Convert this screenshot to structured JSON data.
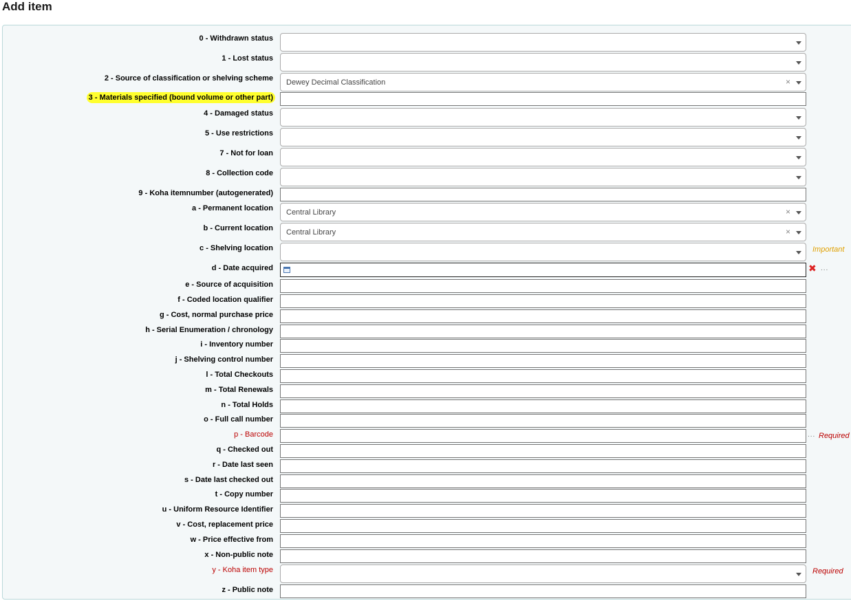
{
  "page": {
    "title": "Add item"
  },
  "hints": {
    "important": "Important",
    "required": "Required"
  },
  "colors": {
    "required": "#bb0000",
    "important": "#e0a000",
    "highlight": "#ffff2e",
    "panel_bg": "#f4f8f9",
    "panel_border": "#b9d8d9"
  },
  "fields": {
    "withdrawn": {
      "label": "0 - Withdrawn status",
      "value": ""
    },
    "lost": {
      "label": "1 - Lost status",
      "value": ""
    },
    "classification": {
      "label": "2 - Source of classification or shelving scheme",
      "value": "Dewey Decimal Classification",
      "clear": "×"
    },
    "materials": {
      "label": "3 - Materials specified (bound volume or other part)",
      "value": ""
    },
    "damaged": {
      "label": "4 - Damaged status",
      "value": ""
    },
    "restrictions": {
      "label": "5 - Use restrictions",
      "value": ""
    },
    "notforloan": {
      "label": "7 - Not for loan",
      "value": ""
    },
    "ccode": {
      "label": "8 - Collection code",
      "value": ""
    },
    "itemnumber": {
      "label": "9 - Koha itemnumber (autogenerated)",
      "value": ""
    },
    "permloc": {
      "label": "a - Permanent location",
      "value": "Central Library",
      "clear": "×"
    },
    "curloc": {
      "label": "b - Current location",
      "value": "Central Library",
      "clear": "×"
    },
    "shelvingloc": {
      "label": "c - Shelving location",
      "value": ""
    },
    "dateacq": {
      "label": "d - Date acquired",
      "value": "",
      "clear": "✖",
      "more": "..."
    },
    "acqsource": {
      "label": "e - Source of acquisition",
      "value": ""
    },
    "codedloc": {
      "label": "f - Coded location qualifier",
      "value": ""
    },
    "cost": {
      "label": "g - Cost, normal purchase price",
      "value": ""
    },
    "serial": {
      "label": "h - Serial Enumeration / chronology",
      "value": ""
    },
    "inventory": {
      "label": "i - Inventory number",
      "value": ""
    },
    "shelvingctrl": {
      "label": "j - Shelving control number",
      "value": ""
    },
    "checkouts": {
      "label": "l - Total Checkouts",
      "value": ""
    },
    "renewals": {
      "label": "m - Total Renewals",
      "value": ""
    },
    "holds": {
      "label": "n - Total Holds",
      "value": ""
    },
    "callnum": {
      "label": "o - Full call number",
      "value": ""
    },
    "barcode": {
      "label": "p - Barcode",
      "value": "",
      "more": "..."
    },
    "checkedout": {
      "label": "q - Checked out",
      "value": ""
    },
    "lastseen": {
      "label": "r - Date last seen",
      "value": ""
    },
    "lastcheckedout": {
      "label": "s - Date last checked out",
      "value": ""
    },
    "copynum": {
      "label": "t - Copy number",
      "value": ""
    },
    "uri": {
      "label": "u - Uniform Resource Identifier",
      "value": ""
    },
    "replcost": {
      "label": "v - Cost, replacement price",
      "value": ""
    },
    "priceeff": {
      "label": "w - Price effective from",
      "value": ""
    },
    "nonpublic": {
      "label": "x - Non-public note",
      "value": ""
    },
    "itemtype": {
      "label": "y - Koha item type",
      "value": ""
    },
    "publicnote": {
      "label": "z - Public note",
      "value": ""
    }
  }
}
